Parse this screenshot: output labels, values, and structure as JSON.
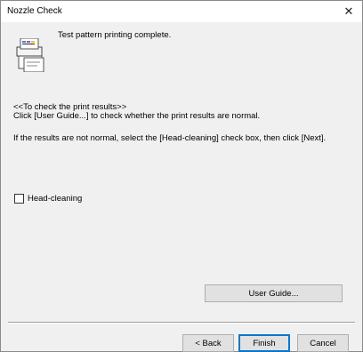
{
  "window": {
    "title": "Nozzle Check",
    "close_glyph": "✕"
  },
  "status": {
    "message": "Test pattern printing complete.",
    "icon": "printer-pages-icon"
  },
  "instructions": {
    "heading": "<<To check the print results>>",
    "line1": "Click [User Guide...] to check whether the print results are normal.",
    "line2": "If the results are not normal, select the [Head-cleaning] check box, then click [Next]."
  },
  "options": {
    "head_cleaning_label": "Head-cleaning",
    "head_cleaning_checked": false
  },
  "buttons": {
    "user_guide": "User Guide...",
    "back": "< Back",
    "finish": "Finish",
    "cancel": "Cancel"
  },
  "colors": {
    "dialog_bg": "#f0f0f0",
    "titlebar_bg": "#ffffff",
    "default_button_border": "#0078d7"
  }
}
